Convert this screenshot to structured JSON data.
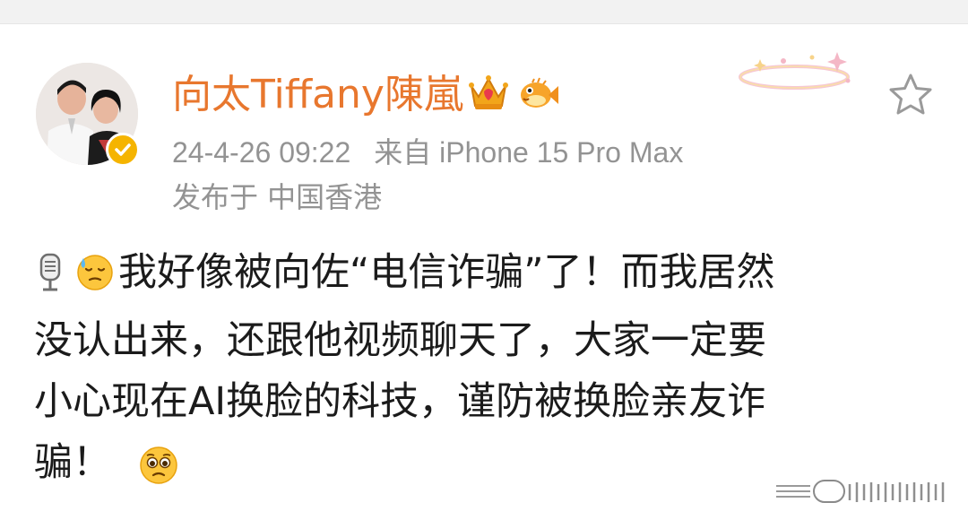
{
  "post": {
    "username": "向太Tiffany陳嵐",
    "time": "24-4-26 09:22",
    "source": "来自 iPhone 15 Pro Max",
    "location": "发布于 中国香港",
    "content_line1": "我好像被向佐“电信诈骗”了！而我居然",
    "content_line2": "没认出来，还跟他视频聊天了，大家一定要",
    "content_line3": "小心现在AI换脸的科技，谨防被换脸亲友诈",
    "content_line4": "骗！"
  },
  "icons": {
    "verified": "verified-badge-icon",
    "crown": "crown-icon",
    "fish": "pufferfish-icon",
    "star": "star-icon",
    "mic": "microphone-icon",
    "sweat": "sweat-face-emoji",
    "pleading": "pleading-face-emoji"
  },
  "colors": {
    "username": "#e8772e",
    "meta": "#939393",
    "verified": "#f5b400",
    "text": "#1b1b1b"
  }
}
